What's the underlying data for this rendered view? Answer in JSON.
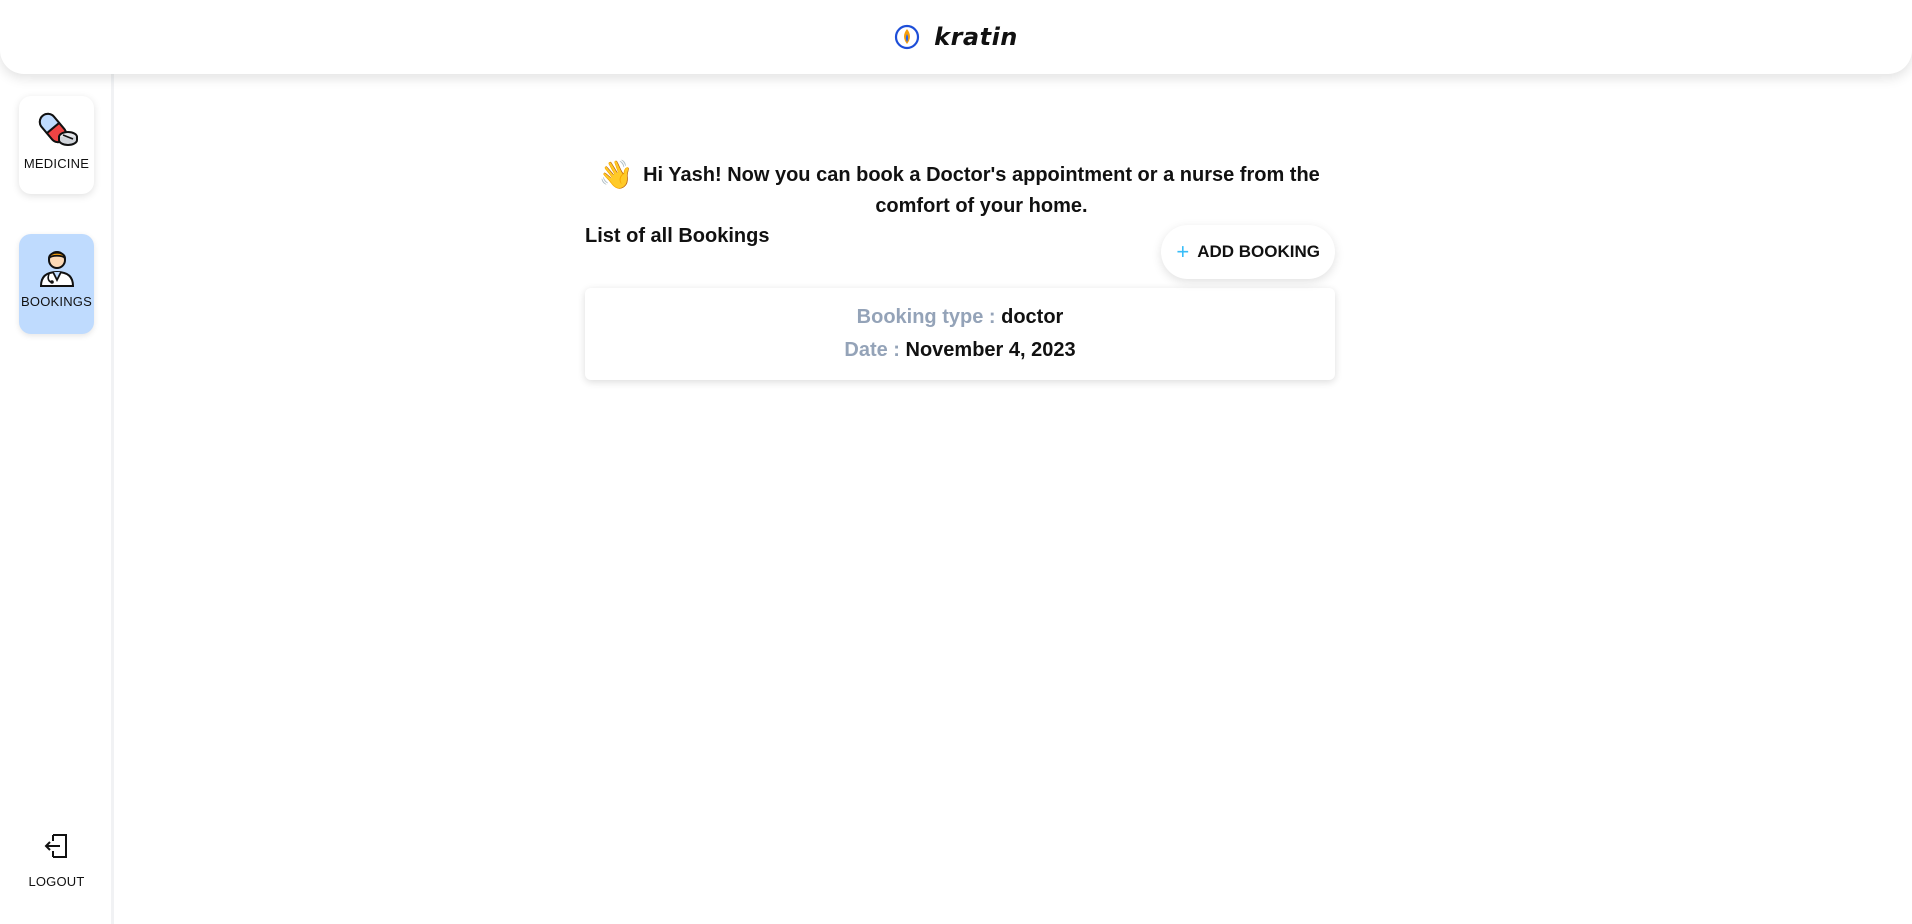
{
  "header": {
    "brand": "kratin",
    "logo_icon": "flame-drop-logo-icon"
  },
  "sidebar": {
    "items": [
      {
        "label": "MEDICINE",
        "icon": "pill-capsule-icon",
        "active": false
      },
      {
        "label": "BOOKINGS",
        "icon": "doctor-icon",
        "active": true
      }
    ],
    "logout": {
      "label": "LOGOUT",
      "icon": "logout-icon"
    }
  },
  "main": {
    "wave_icon": "waving-hand-icon",
    "greeting": "Hi Yash! Now you can book a Doctor's appointment or a nurse from the comfort of your home.",
    "list_title": "List of all Bookings",
    "add_button": "ADD BOOKING",
    "bookings": [
      {
        "type_label": "Booking type :",
        "type_value": "doctor",
        "date_label": "Date :",
        "date_value": "November 4, 2023"
      }
    ]
  },
  "colors": {
    "active_bg": "#bfdbfe",
    "muted_label": "#94a3b8",
    "plus_accent": "#38bdf8"
  }
}
